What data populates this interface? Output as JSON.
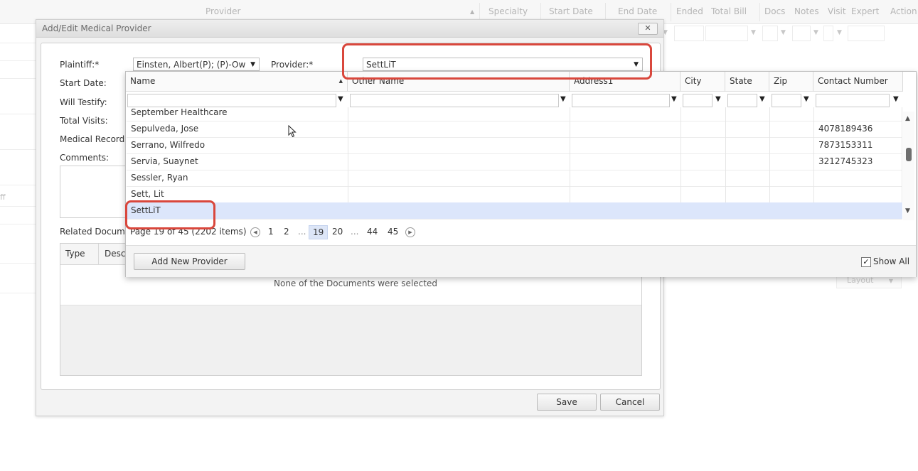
{
  "background_grid": {
    "columns": [
      "Provider",
      "Specialty",
      "Start Date",
      "End Date",
      "Ended",
      "Total Bill",
      "Docs",
      "Notes",
      "Visit",
      "Expert",
      "Action"
    ],
    "left_partial_text": "ff",
    "layout_button": "Layout"
  },
  "dialog": {
    "title": "Add/Edit Medical Provider",
    "close_label": "✕",
    "labels": {
      "plaintiff": "Plaintiff:*",
      "provider": "Provider:*",
      "start_date": "Start Date:",
      "will_testify": "Will Testify:",
      "total_visits": "Total Visits:",
      "medical_records": "Medical Records",
      "comments": "Comments:",
      "related_documents": "Related Docume"
    },
    "plaintiff_value": "Einsten, Albert(P); (P)-Ow",
    "provider_value": "SettLiT",
    "documents_grid": {
      "columns": [
        "Type",
        "Desc"
      ],
      "empty_message": "None of the Documents were selected"
    },
    "save_label": "Save",
    "cancel_label": "Cancel"
  },
  "provider_dropdown": {
    "columns": [
      "Name",
      "Other Name",
      "Address1",
      "City",
      "State",
      "Zip",
      "Contact Number"
    ],
    "rows": [
      {
        "name": "September Healthcare",
        "other_name": "",
        "address1": "",
        "city": "",
        "state": "",
        "zip": "",
        "contact": ""
      },
      {
        "name": "Sepulveda, Jose",
        "other_name": "",
        "address1": "",
        "city": "",
        "state": "",
        "zip": "",
        "contact": "4078189436"
      },
      {
        "name": "Serrano, Wilfredo",
        "other_name": "",
        "address1": "",
        "city": "",
        "state": "",
        "zip": "",
        "contact": "7873153311"
      },
      {
        "name": "Servia, Suaynet",
        "other_name": "",
        "address1": "",
        "city": "",
        "state": "",
        "zip": "",
        "contact": "3212745323"
      },
      {
        "name": "Sessler, Ryan",
        "other_name": "",
        "address1": "",
        "city": "",
        "state": "",
        "zip": "",
        "contact": ""
      },
      {
        "name": "Sett, Lit",
        "other_name": "",
        "address1": "",
        "city": "",
        "state": "",
        "zip": "",
        "contact": ""
      },
      {
        "name": "SettLiT",
        "other_name": "",
        "address1": "",
        "city": "",
        "state": "",
        "zip": "",
        "contact": ""
      }
    ],
    "selected_row": "SettLiT",
    "pager": {
      "summary": "Page 19 of 45 (2202 items)",
      "pages": [
        "1",
        "2",
        "...",
        "19",
        "20",
        "...",
        "44",
        "45"
      ],
      "current_page": "19"
    },
    "add_new_label": "Add New Provider",
    "show_all_label": "Show All",
    "show_all_checked": true
  },
  "highlight_color": "#d9473c"
}
